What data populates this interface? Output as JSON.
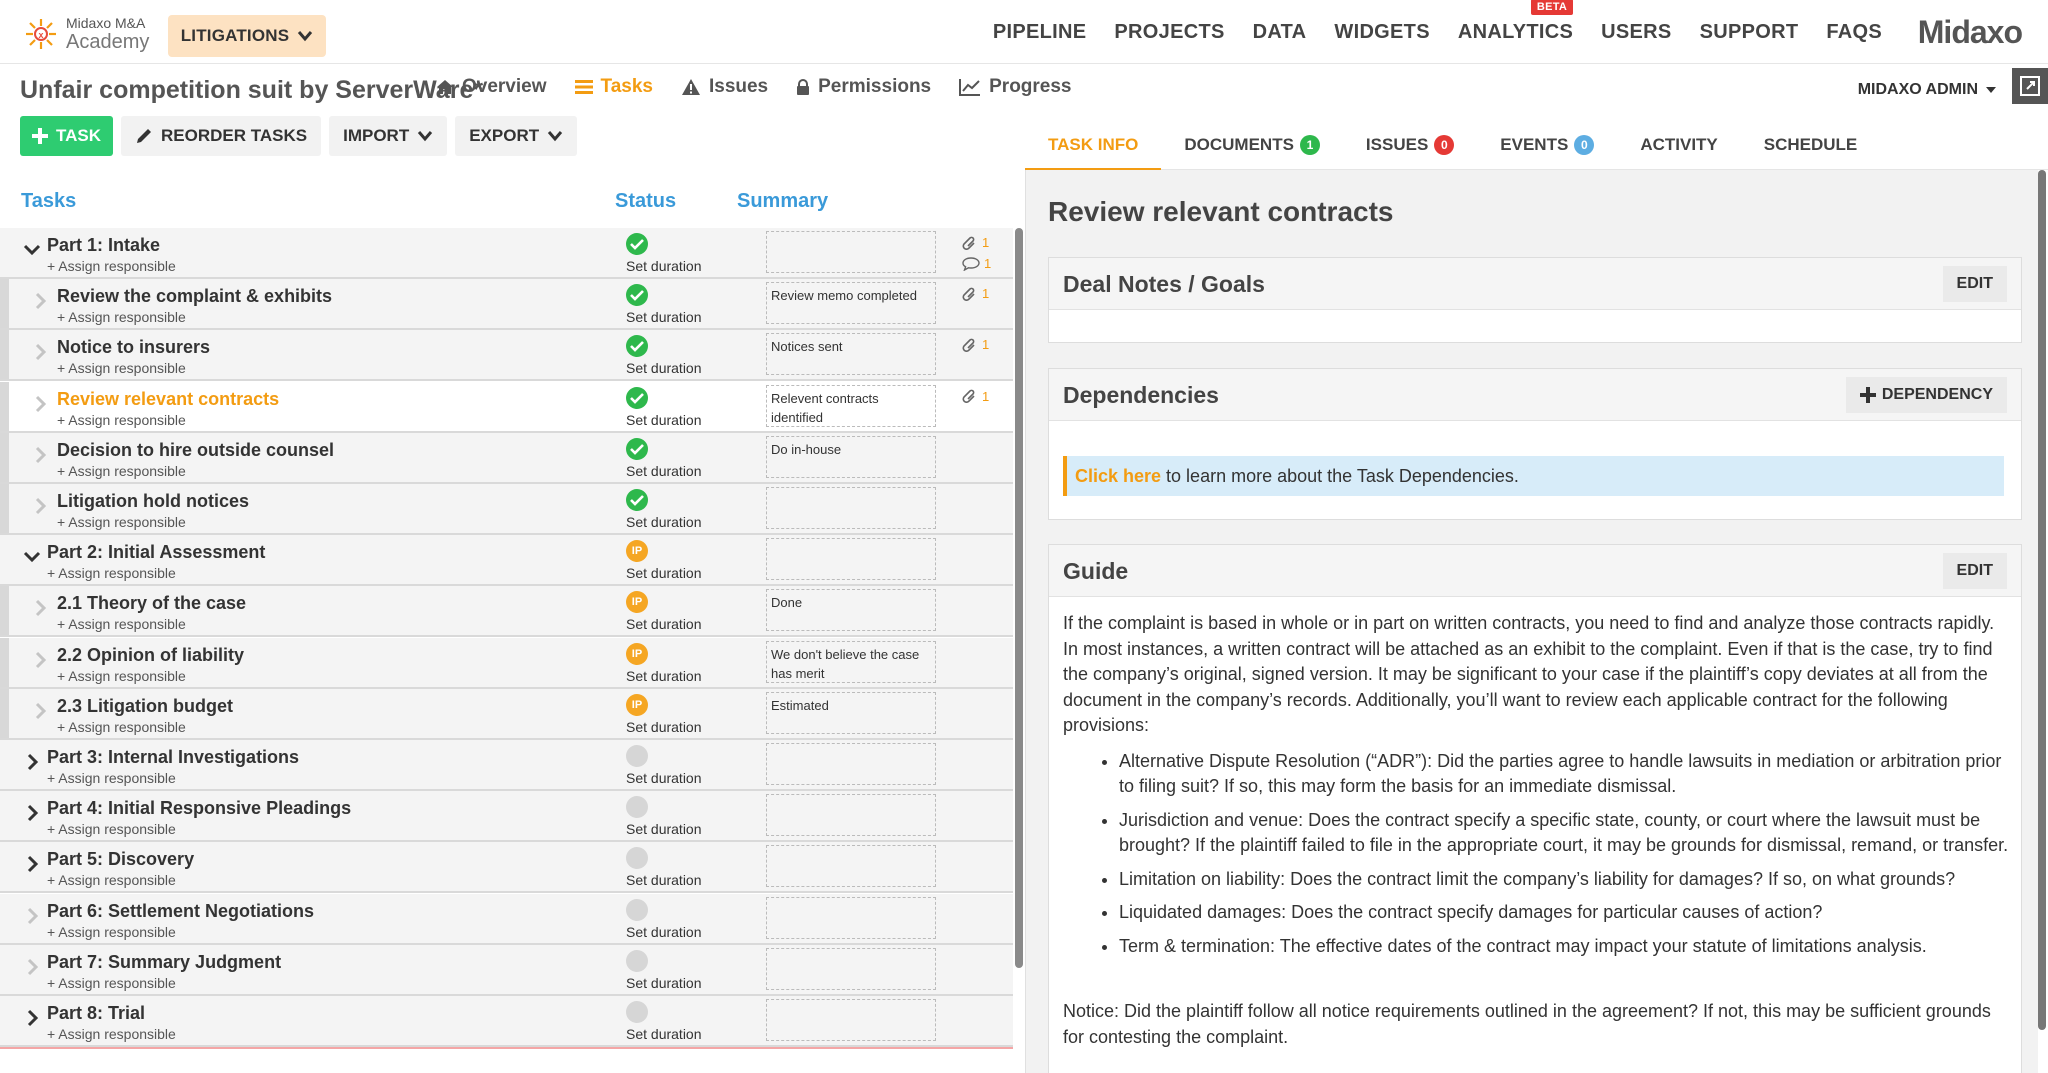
{
  "topnav": {
    "logo_line1": "Midaxo M&A",
    "logo_line2": "Academy",
    "module_button": "LITIGATIONS",
    "items": [
      "PIPELINE",
      "PROJECTS",
      "DATA",
      "WIDGETS",
      "ANALYTICS",
      "USERS",
      "SUPPORT",
      "FAQS"
    ],
    "beta_label": "BETA",
    "brand": "Midaxo"
  },
  "project": {
    "title": "Unfair competition suit by ServerWare*",
    "tabs": [
      "Overview",
      "Tasks",
      "Issues",
      "Permissions",
      "Progress"
    ],
    "active_tab": "Tasks",
    "admin_label": "MIDAXO ADMIN"
  },
  "toolbar": {
    "task": "TASK",
    "reorder": "REORDER TASKS",
    "import": "IMPORT",
    "export": "EXPORT"
  },
  "task_columns": {
    "tasks": "Tasks",
    "status": "Status",
    "summary": "Summary"
  },
  "tasks": [
    {
      "name": "Part 1: Intake",
      "assign": "+ Assign responsible",
      "status": "done",
      "duration": "Set duration",
      "summary": "",
      "attachments": "1",
      "comments": "1",
      "level": 0,
      "expand": "open"
    },
    {
      "name": "Review the complaint & exhibits",
      "assign": "+ Assign responsible",
      "status": "done",
      "duration": "Set duration",
      "summary": "Review memo completed",
      "attachments": "1",
      "level": 1
    },
    {
      "name": "Notice to insurers",
      "assign": "+ Assign responsible",
      "status": "done",
      "duration": "Set duration",
      "summary": "Notices sent",
      "attachments": "1",
      "level": 1
    },
    {
      "name": "Review relevant contracts",
      "assign": "+ Assign responsible",
      "status": "done",
      "duration": "Set duration",
      "summary": "Relevent contracts identified",
      "attachments": "1",
      "level": 1,
      "highlight": true
    },
    {
      "name": "Decision to hire outside counsel",
      "assign": "+ Assign responsible",
      "status": "done",
      "duration": "Set duration",
      "summary": "Do in-house",
      "level": 1
    },
    {
      "name": "Litigation hold notices",
      "assign": "+ Assign responsible",
      "status": "done",
      "duration": "Set duration",
      "summary": "",
      "level": 1
    },
    {
      "name": "Part 2: Initial Assessment",
      "assign": "+ Assign responsible",
      "status": "ip",
      "duration": "Set duration",
      "summary": "",
      "level": 0,
      "expand": "open"
    },
    {
      "name": "2.1 Theory of the case",
      "assign": "+ Assign responsible",
      "status": "ip",
      "duration": "Set duration",
      "summary": "Done",
      "level": 1
    },
    {
      "name": "2.2 Opinion of liability",
      "assign": "+ Assign responsible",
      "status": "ip",
      "duration": "Set duration",
      "summary": "We don't believe the case has merit",
      "level": 1
    },
    {
      "name": "2.3 Litigation budget",
      "assign": "+ Assign responsible",
      "status": "ip",
      "duration": "Set duration",
      "summary": "Estimated",
      "level": 1
    },
    {
      "name": "Part 3: Internal Investigations",
      "assign": "+ Assign responsible",
      "status": "none",
      "duration": "Set duration",
      "summary": "",
      "level": 0,
      "expand": "closed"
    },
    {
      "name": "Part 4: Initial Responsive Pleadings",
      "assign": "+ Assign responsible",
      "status": "none",
      "duration": "Set duration",
      "summary": "",
      "level": 0,
      "expand": "closed"
    },
    {
      "name": "Part 5: Discovery",
      "assign": "+ Assign responsible",
      "status": "none",
      "duration": "Set duration",
      "summary": "",
      "level": 0,
      "expand": "closed"
    },
    {
      "name": "Part 6: Settlement Negotiations",
      "assign": "+ Assign responsible",
      "status": "none",
      "duration": "Set duration",
      "summary": "",
      "level": 0,
      "expand": "empty"
    },
    {
      "name": "Part 7: Summary Judgment",
      "assign": "+ Assign responsible",
      "status": "none",
      "duration": "Set duration",
      "summary": "",
      "level": 0,
      "expand": "empty"
    },
    {
      "name": "Part 8: Trial",
      "assign": "+ Assign responsible",
      "status": "none",
      "duration": "Set duration",
      "summary": "",
      "level": 0,
      "expand": "closed"
    }
  ],
  "status_ip_label": "IP",
  "right_tabs": [
    {
      "label": "TASK INFO",
      "badge": "",
      "color": ""
    },
    {
      "label": "DOCUMENTS",
      "badge": "1",
      "color": "green"
    },
    {
      "label": "ISSUES",
      "badge": "0",
      "color": "red"
    },
    {
      "label": "EVENTS",
      "badge": "0",
      "color": "blue"
    },
    {
      "label": "ACTIVITY",
      "badge": "",
      "color": ""
    },
    {
      "label": "SCHEDULE",
      "badge": "",
      "color": ""
    }
  ],
  "detail": {
    "title": "Review relevant contracts",
    "deal_notes_title": "Deal Notes / Goals",
    "edit_label": "EDIT",
    "dependencies_title": "Dependencies",
    "dependency_button": "DEPENDENCY",
    "dependency_link": "Click here",
    "dependency_text": "to learn more about the Task Dependencies.",
    "guide_title": "Guide",
    "guide_intro": "If the complaint is based in whole or in part on written contracts, you need to find and analyze those contracts rapidly. In most instances, a written contract will be attached as an exhibit to the complaint. Even if that is the case, try to find the company’s original, signed version. It may be significant to your case if the plaintiff’s copy deviates at all from the document in the company’s records. Additionally, you’ll want to review each applicable contract for the following provisions:",
    "guide_items": [
      "Alternative Dispute Resolution (“ADR”): Did the parties agree to handle lawsuits in mediation or arbitration prior to filing suit? If so, this may form the basis for an immediate dismissal.",
      "Jurisdiction and venue: Does the contract specify a specific state, county, or court where the lawsuit must be brought? If the plaintiff failed to file in the appropriate court, it may be grounds for dismissal, remand, or transfer.",
      "Limitation on liability: Does the contract limit the company’s liability for damages? If so, on what grounds?",
      "Liquidated damages: Does the contract specify damages for particular causes of action?",
      "Term & termination: The effective dates of the contract may impact your statute of limitations analysis."
    ],
    "guide_notice": "Notice: Did the plaintiff follow all notice requirements outlined in the agreement? If not, this may be sufficient grounds for contesting the complaint."
  },
  "colors": {
    "accent": "#f39c12",
    "link_blue": "#3a9ad9",
    "done": "#2eb84c",
    "ip": "#f5a623"
  }
}
